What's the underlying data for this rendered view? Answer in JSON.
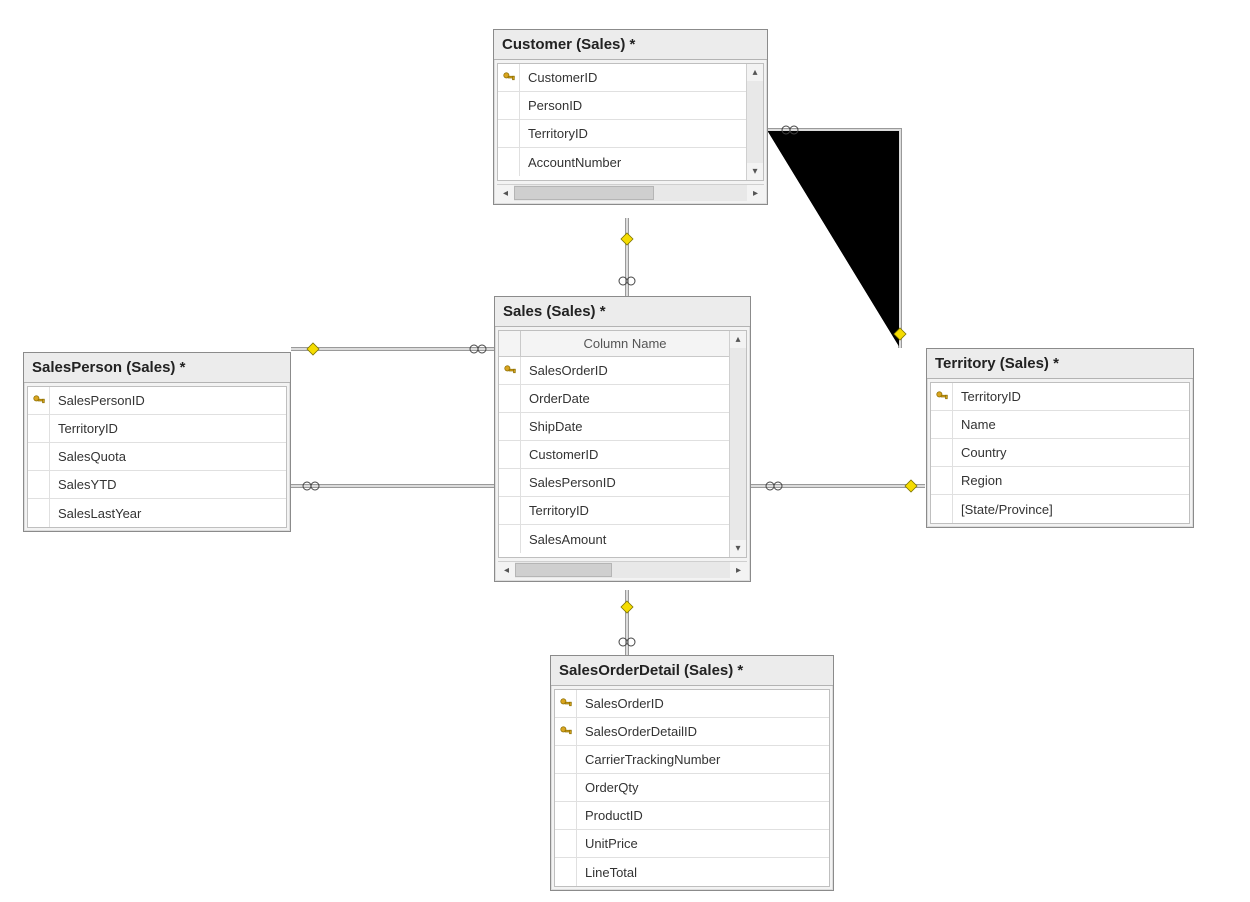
{
  "tables": {
    "customer": {
      "title": "Customer (Sales) *",
      "columns": [
        {
          "name": "CustomerID",
          "pk": true
        },
        {
          "name": "PersonID",
          "pk": false
        },
        {
          "name": "TerritoryID",
          "pk": false
        },
        {
          "name": "AccountNumber",
          "pk": false
        }
      ]
    },
    "sales": {
      "title": "Sales (Sales) *",
      "columnHeader": "Column Name",
      "columns": [
        {
          "name": "SalesOrderID",
          "pk": true
        },
        {
          "name": "OrderDate",
          "pk": false
        },
        {
          "name": "ShipDate",
          "pk": false
        },
        {
          "name": "CustomerID",
          "pk": false
        },
        {
          "name": "SalesPersonID",
          "pk": false
        },
        {
          "name": "TerritoryID",
          "pk": false
        },
        {
          "name": "SalesAmount",
          "pk": false
        }
      ]
    },
    "salesperson": {
      "title": "SalesPerson (Sales) *",
      "columns": [
        {
          "name": "SalesPersonID",
          "pk": true
        },
        {
          "name": "TerritoryID",
          "pk": false
        },
        {
          "name": "SalesQuota",
          "pk": false
        },
        {
          "name": "SalesYTD",
          "pk": false
        },
        {
          "name": "SalesLastYear",
          "pk": false
        }
      ]
    },
    "territory": {
      "title": "Territory (Sales) *",
      "columns": [
        {
          "name": "TerritoryID",
          "pk": true
        },
        {
          "name": "Name",
          "pk": false
        },
        {
          "name": "Country",
          "pk": false
        },
        {
          "name": "Region",
          "pk": false
        },
        {
          "name": "[State/Province]",
          "pk": false
        }
      ]
    },
    "salesorderdetail": {
      "title": "SalesOrderDetail (Sales) *",
      "columns": [
        {
          "name": "SalesOrderID",
          "pk": true
        },
        {
          "name": "SalesOrderDetailID",
          "pk": true
        },
        {
          "name": "CarrierTrackingNumber",
          "pk": false
        },
        {
          "name": "OrderQty",
          "pk": false
        },
        {
          "name": "ProductID",
          "pk": false
        },
        {
          "name": "UnitPrice",
          "pk": false
        },
        {
          "name": "LineTotal",
          "pk": false
        }
      ]
    }
  },
  "relationships": [
    {
      "from": "customer",
      "to": "sales"
    },
    {
      "from": "customer",
      "to": "territory"
    },
    {
      "from": "salesperson",
      "to": "sales"
    },
    {
      "from": "salesperson",
      "to": "territory"
    },
    {
      "from": "sales",
      "to": "territory"
    },
    {
      "from": "sales",
      "to": "salesorderdetail"
    }
  ]
}
